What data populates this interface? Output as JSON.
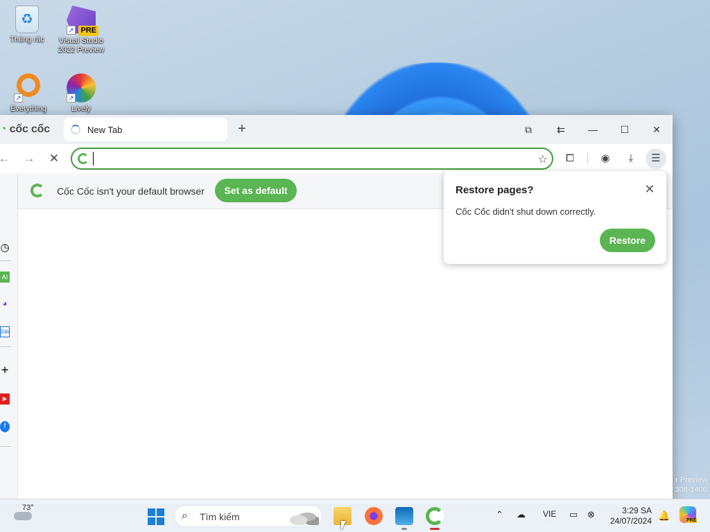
{
  "desktop": {
    "icons": [
      {
        "label": "Thùng rác"
      },
      {
        "label": "Visual Studio 2022 Preview",
        "badge": "PRE"
      },
      {
        "label": "Everything"
      },
      {
        "label": "Lively"
      }
    ],
    "watermark_line1": "r Preview",
    "watermark_line2": "308-1400"
  },
  "browser": {
    "brand": "cốc cốc",
    "tab_title": "New Tab",
    "address_value": "",
    "infobar_text": "Cốc Cốc isn't your default browser",
    "set_default_label": "Set as default",
    "accent_color": "#5ab552"
  },
  "popup": {
    "title": "Restore pages?",
    "message": "Cốc Cốc didn't shut down correctly.",
    "restore_label": "Restore"
  },
  "sidebar": {
    "ai_label": "AI",
    "zalo_label": "Zalo"
  },
  "taskbar": {
    "weather_temp": "73°",
    "search_placeholder": "Tìm kiếm",
    "language": "VIE",
    "time": "3:29 SA",
    "date": "24/07/2024",
    "copilot_badge": "PRE"
  }
}
